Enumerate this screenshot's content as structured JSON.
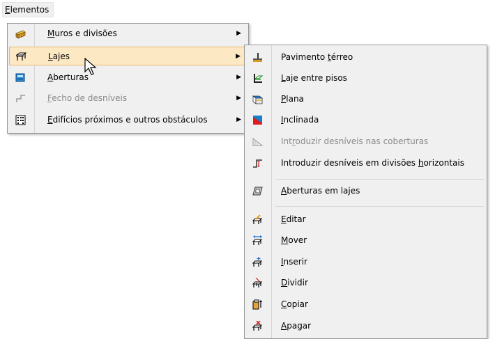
{
  "menubar": {
    "title_u": "E",
    "title_rest": "lementos"
  },
  "dropdown": {
    "items": [
      {
        "u": "M",
        "rest": "uros e divisões",
        "icon": "wall-icon",
        "arrow": "▶"
      },
      {
        "u": "L",
        "rest": "ajes",
        "icon": "slab-icon",
        "arrow": "▶"
      },
      {
        "u": "A",
        "rest": "berturas",
        "icon": "opening-icon",
        "arrow": "▶"
      },
      {
        "u": "F",
        "rest": "echo de desníveis",
        "icon": "level-closure-icon",
        "arrow": "▶"
      },
      {
        "u": "E",
        "rest": "difícios próximos e outros obstáculos",
        "icon": "building-icon",
        "arrow": "▶"
      }
    ]
  },
  "submenu": {
    "items": [
      {
        "pre": "Pavimento ",
        "u": "t",
        "post": "érreo",
        "icon": "ground-floor-icon"
      },
      {
        "pre": "",
        "u": "L",
        "post": "aje entre pisos",
        "icon": "interfloor-slab-icon"
      },
      {
        "pre": "",
        "u": "P",
        "post": "lana",
        "icon": "flat-roof-icon"
      },
      {
        "pre": "",
        "u": "I",
        "post": "nclinada",
        "icon": "inclined-roof-icon"
      },
      {
        "pre": "Int",
        "u": "r",
        "post": "oduzir desníveis nas coberturas",
        "icon": "roof-level-icon"
      },
      {
        "pre": "Introduzir desníveis em divisões ",
        "u": "h",
        "post": "orizontais",
        "icon": "horizontal-level-icon"
      },
      {
        "pre": "",
        "u": "A",
        "post": "berturas em lajes",
        "icon": "slab-opening-icon"
      },
      {
        "pre": "",
        "u": "E",
        "post": "ditar",
        "icon": "edit-icon"
      },
      {
        "pre": "",
        "u": "M",
        "post": "over",
        "icon": "move-icon"
      },
      {
        "pre": "",
        "u": "I",
        "post": "nserir",
        "icon": "insert-icon"
      },
      {
        "pre": "",
        "u": "D",
        "post": "ividir",
        "icon": "divide-icon"
      },
      {
        "pre": "",
        "u": "C",
        "post": "opiar",
        "icon": "copy-icon"
      },
      {
        "pre": "",
        "u": "A",
        "post": "pagar",
        "icon": "delete-icon"
      }
    ]
  }
}
